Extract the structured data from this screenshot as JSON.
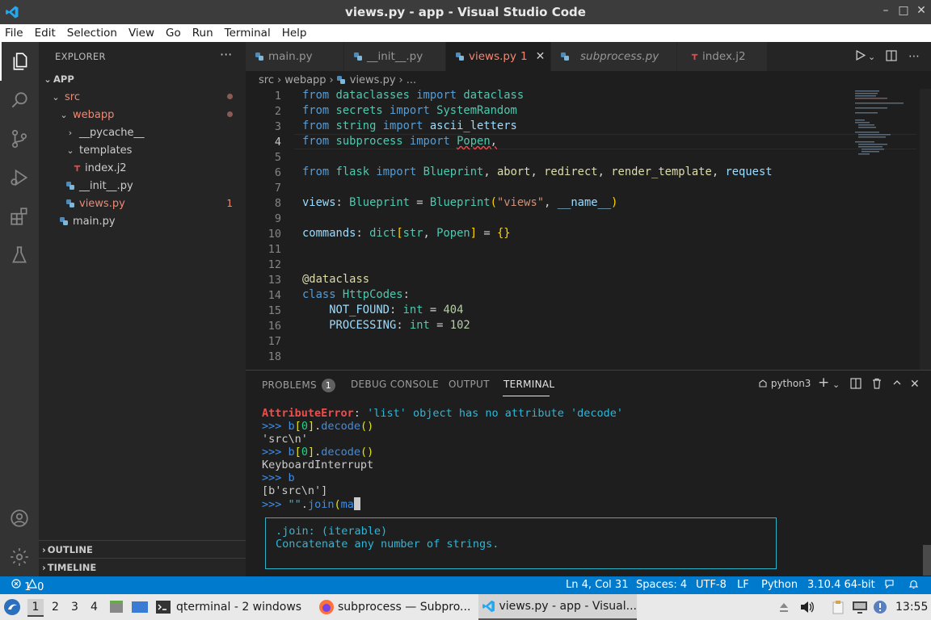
{
  "window": {
    "title": "views.py - app - Visual Studio Code",
    "controls": [
      "–",
      "□",
      "✕"
    ]
  },
  "menu": [
    "File",
    "Edit",
    "Selection",
    "View",
    "Go",
    "Run",
    "Terminal",
    "Help"
  ],
  "explorer": {
    "header": "EXPLORER",
    "more": "···",
    "root": "APP",
    "tree": [
      {
        "label": "src"
      },
      {
        "label": "webapp"
      },
      {
        "label": "__pycache__"
      },
      {
        "label": "templates"
      },
      {
        "label": "index.j2"
      },
      {
        "label": "__init__.py"
      },
      {
        "label": "views.py",
        "badge": "1"
      },
      {
        "label": "main.py"
      }
    ],
    "outline": "OUTLINE",
    "timeline": "TIMELINE"
  },
  "tabs": [
    {
      "label": "main.py"
    },
    {
      "label": "__init__.py"
    },
    {
      "label": "views.py",
      "badge": "1"
    },
    {
      "label": "subprocess.py"
    },
    {
      "label": "index.j2"
    }
  ],
  "breadcrumb": [
    "src",
    "webapp",
    "views.py",
    "..."
  ],
  "editor": {
    "line_numbers": [
      "1",
      "2",
      "3",
      "4",
      "5",
      "6",
      "7",
      "8",
      "9",
      "10",
      "11",
      "12",
      "13",
      "14",
      "15",
      "16",
      "17",
      "18"
    ],
    "current_line": 4
  },
  "panel": {
    "tabs": [
      "PROBLEMS",
      "DEBUG CONSOLE",
      "OUTPUT",
      "TERMINAL"
    ],
    "problems_count": "1",
    "terminal_profile": "python3",
    "hover_signature": ".join: (iterable)",
    "hover_doc": "Concatenate any number of strings."
  },
  "statusbar": {
    "errors": "1",
    "warnings": "0",
    "position": "Ln 4, Col 31",
    "spaces": "Spaces: 4",
    "encoding": "UTF-8",
    "eol": "LF",
    "language": "Python",
    "interpreter": "3.10.4 64-bit"
  },
  "taskbar": {
    "workspaces": [
      "1",
      "2",
      "3",
      "4"
    ],
    "tasks": [
      "qterminal - 2 windows",
      "subprocess — Subpro...",
      "views.py - app - Visual..."
    ],
    "clock": "13:55"
  },
  "colors": {
    "accent": "#007acc",
    "error": "#f48771"
  }
}
